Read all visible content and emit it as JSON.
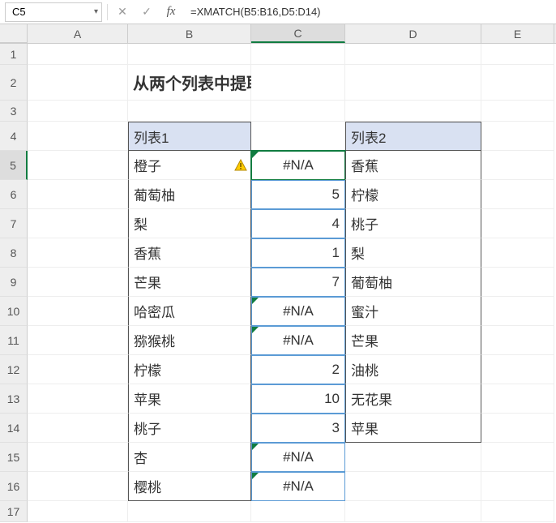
{
  "active_cell": "C5",
  "formula": "=XMATCH(B5:B16,D5:D14)",
  "columns": [
    "A",
    "B",
    "C",
    "D",
    "E"
  ],
  "col_widths": {
    "A": 124,
    "B": 152,
    "C": 116,
    "D": 168,
    "E": 90
  },
  "title": "从两个列表中提取相同值",
  "headers": {
    "list1": "列表1",
    "list2": "列表2"
  },
  "list1": [
    "橙子",
    "葡萄柚",
    "梨",
    "香蕉",
    "芒果",
    "哈密瓜",
    "猕猴桃",
    "柠檬",
    "苹果",
    "桃子",
    "杏",
    "樱桃"
  ],
  "list2": [
    "香蕉",
    "柠檬",
    "桃子",
    "梨",
    "葡萄柚",
    "蜜汁",
    "芒果",
    "油桃",
    "无花果",
    "苹果"
  ],
  "results": [
    "#N/A",
    "5",
    "4",
    "1",
    "7",
    "#N/A",
    "#N/A",
    "2",
    "10",
    "3",
    "#N/A",
    "#N/A"
  ],
  "result_is_number": [
    false,
    true,
    true,
    true,
    true,
    false,
    false,
    true,
    true,
    true,
    false,
    false
  ],
  "row_count": 17,
  "chart_data": null
}
